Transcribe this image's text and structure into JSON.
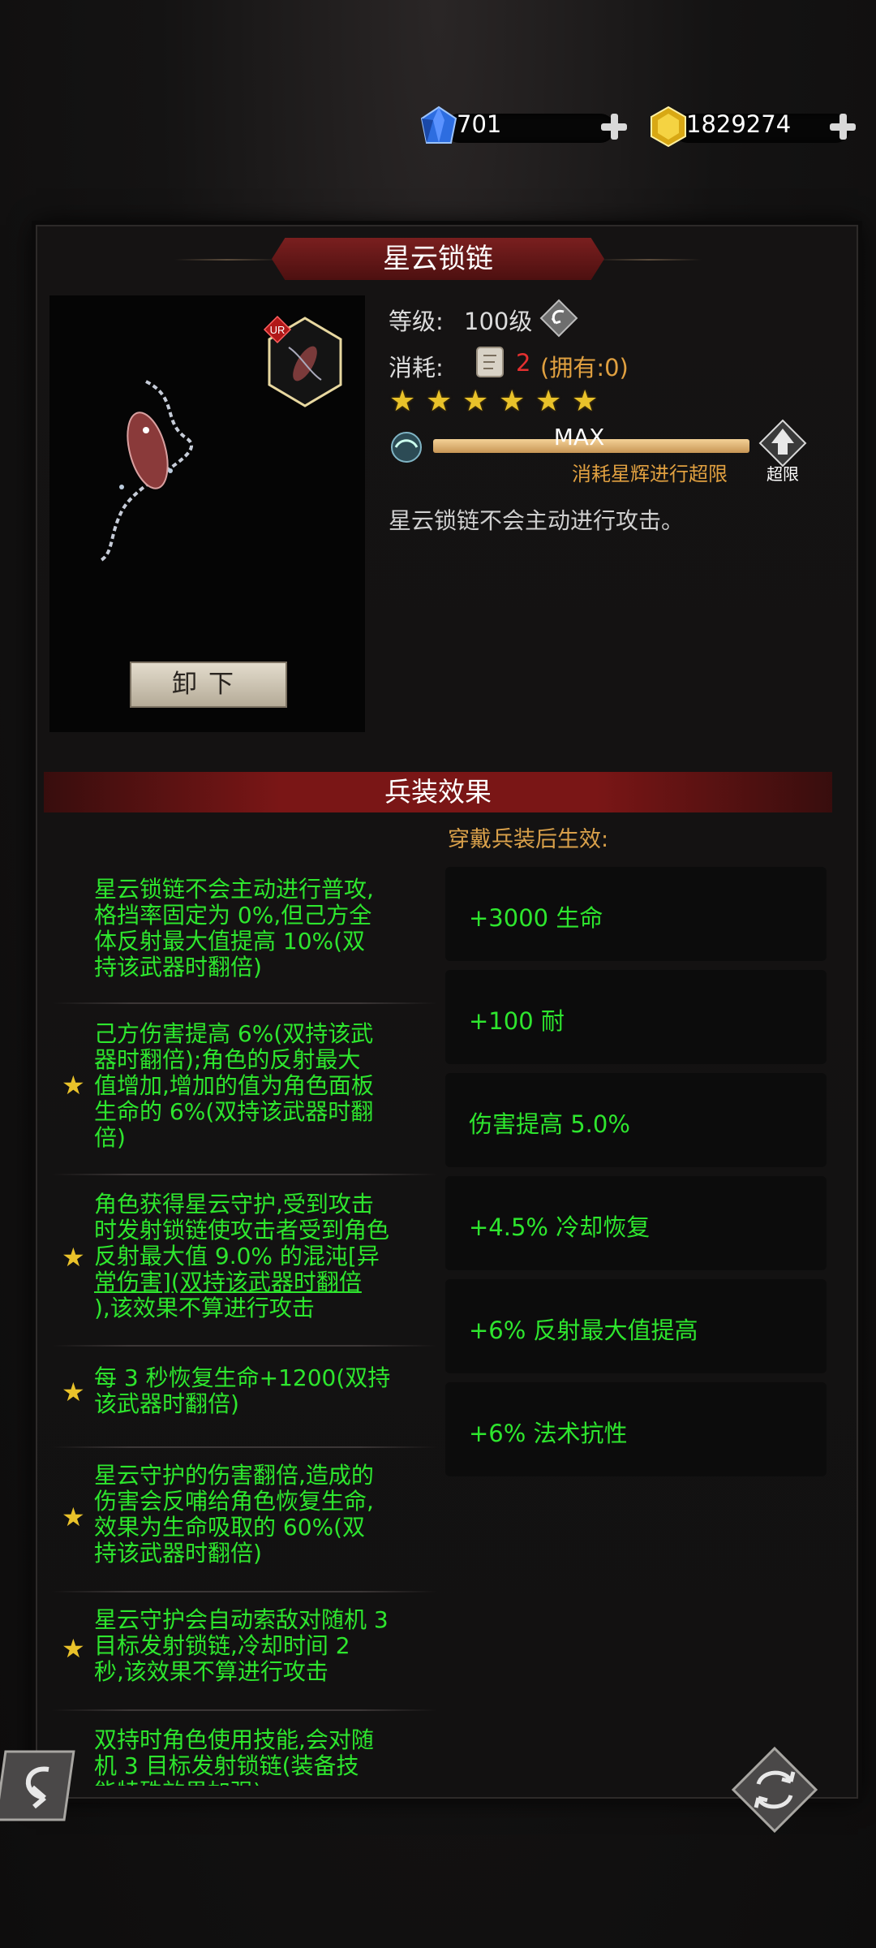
{
  "currency": {
    "gems": "701",
    "gold": "1829274"
  },
  "item": {
    "title": "星云锁链",
    "rarity_badge": "UR",
    "level_label": "等级:",
    "level_value": "100级",
    "cost_label": "消耗:",
    "cost_amount": "2",
    "cost_owned": "(拥有:0)",
    "stars": 6,
    "progress_max_label": "MAX",
    "progress_fraction": 1.0,
    "progress_hint": "消耗星辉进行超限",
    "limit_break_label": "超限",
    "description": "星云锁链不会主动进行攻击。",
    "unequip_label": "卸下"
  },
  "effects": {
    "title": "兵装效果",
    "stats_header": "穿戴兵装后生效:",
    "passives": [
      {
        "starred": false,
        "text_lines": [
          "星云锁链不会主动进行普攻,",
          "格挡率固定为 0%,但己方全",
          "体反射最大值提高 10%(双",
          "持该武器时翻倍)"
        ]
      },
      {
        "starred": true,
        "text_lines": [
          "己方伤害提高 6%(双持该武",
          "器时翻倍);角色的反射最大",
          "值增加,增加的值为角色面板",
          "生命的 6%(双持该武器时翻",
          "倍)"
        ]
      },
      {
        "starred": true,
        "text_lines": [
          "角色获得星云守护,受到攻击",
          "时发射锁链使攻击者受到角色",
          "反射最大值 9.0% 的混沌[异",
          "常伤害](双持该武器时翻倍",
          "),该效果不算进行攻击"
        ]
      },
      {
        "starred": true,
        "text_lines": [
          "每 3 秒恢复生命+1200(双持",
          "该武器时翻倍)"
        ]
      },
      {
        "starred": true,
        "text_lines": [
          "星云守护的伤害翻倍,造成的",
          "伤害会反哺给角色恢复生命,",
          "效果为生命吸取的 60%(双",
          "持该武器时翻倍)"
        ]
      },
      {
        "starred": true,
        "text_lines": [
          "星云守护会自动索敌对随机 3",
          "目标发射锁链,冷却时间 2",
          "秒,该效果不算进行攻击"
        ]
      },
      {
        "starred": false,
        "text_lines": [
          "双持时角色使用技能,会对随",
          "机 3 目标发射锁链(装备技",
          "能特殊效果加强)"
        ]
      }
    ],
    "stats": [
      "+3000 生命",
      "+100 耐",
      "伤害提高 5.0%",
      "+4.5% 冷却恢复",
      "+6% 反射最大值提高",
      "+6% 法术抗性"
    ]
  },
  "colors": {
    "effect_green": "#2ee62e",
    "banner_red": "#7a1616",
    "star_gold": "#e9c22a",
    "cost_red": "#e53030",
    "cost_owned_orange": "#e0a040",
    "hint_orange": "#e0a040"
  }
}
